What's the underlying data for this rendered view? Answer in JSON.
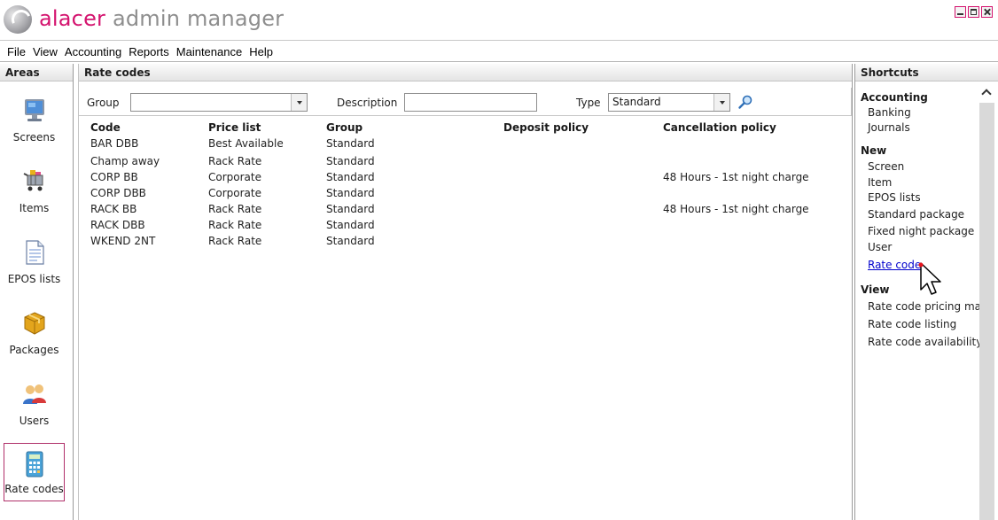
{
  "app": {
    "brand": "alacer",
    "title_rest": " admin manager"
  },
  "menu": [
    "File",
    "View",
    "Accounting",
    "Reports",
    "Maintenance",
    "Help"
  ],
  "areas": {
    "header": "Areas",
    "items": [
      {
        "label": "Screens",
        "icon": "monitor-icon",
        "selected": false
      },
      {
        "label": "Items",
        "icon": "shopping-cart-icon",
        "selected": false
      },
      {
        "label": "EPOS lists",
        "icon": "document-icon",
        "selected": false
      },
      {
        "label": "Packages",
        "icon": "package-icon",
        "selected": false
      },
      {
        "label": "Users",
        "icon": "users-icon",
        "selected": false
      },
      {
        "label": "Rate codes",
        "icon": "calculator-icon",
        "selected": true
      }
    ]
  },
  "main": {
    "header": "Rate codes",
    "filters": {
      "group_label": "Group",
      "group_value": "",
      "description_label": "Description",
      "description_value": "",
      "type_label": "Type",
      "type_value": "Standard"
    },
    "columns": [
      "Code",
      "Price list",
      "Group",
      "Deposit policy",
      "Cancellation policy"
    ],
    "rows": [
      [
        "BAR DBB",
        "Best Available",
        "Standard",
        "",
        ""
      ],
      [
        "Champ away",
        "Rack Rate",
        "Standard",
        "",
        ""
      ],
      [
        "CORP BB",
        "Corporate",
        "Standard",
        "",
        "48 Hours - 1st night charge"
      ],
      [
        "CORP DBB",
        "Corporate",
        "Standard",
        "",
        ""
      ],
      [
        "RACK BB",
        "Rack Rate",
        "Standard",
        "",
        "48 Hours - 1st night charge"
      ],
      [
        "RACK DBB",
        "Rack Rate",
        "Standard",
        "",
        ""
      ],
      [
        "WKEND 2NT",
        "Rack Rate",
        "Standard",
        "",
        ""
      ]
    ]
  },
  "shortcuts": {
    "header": "Shortcuts",
    "groups": [
      {
        "title": "Accounting",
        "items": [
          "Banking",
          "Journals"
        ]
      },
      {
        "title": "New",
        "items": [
          "Screen",
          "Item",
          "EPOS lists",
          "Standard package",
          "Fixed night package",
          "User",
          "Rate code"
        ]
      },
      {
        "title": "View",
        "items": [
          "Rate code pricing map",
          "Rate code listing",
          "Rate code availability"
        ]
      }
    ]
  },
  "colors": {
    "brand": "#d4146f",
    "link": "#0000cc",
    "selected_border": "#b0306a"
  }
}
